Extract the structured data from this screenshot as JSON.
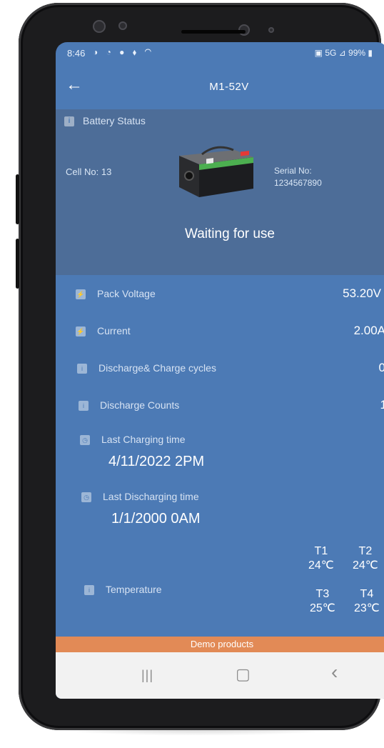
{
  "status_bar": {
    "time": "8:46",
    "left_icons": "◑ ◔ ● ⬧ ◠",
    "right_text": "▣ 5G ⊿ 99% ▮"
  },
  "app_bar": {
    "title": "M1-52V",
    "back_icon": "arrow-left"
  },
  "battery_status": {
    "section_label": "Battery Status",
    "cell_no": "Cell No:  13",
    "serial_label": "Serial No:",
    "serial_value": "1234567890",
    "state": "Waiting for use"
  },
  "metrics": [
    {
      "label": "Pack Voltage",
      "value": "53.20V"
    },
    {
      "label": "Current",
      "value": "2.00A"
    },
    {
      "label": "Discharge& Charge cycles",
      "value": "0"
    },
    {
      "label": "Discharge Counts",
      "value": "1"
    }
  ],
  "times": {
    "last_charging_label": "Last Charging time",
    "last_charging_value": "4/11/2022 2PM",
    "last_discharging_label": "Last Discharging time",
    "last_discharging_value": "1/1/2000 0AM"
  },
  "temperature": {
    "label": "Temperature",
    "t1_label": "T1",
    "t1_value": "24℃",
    "t2_label": "T2",
    "t2_value": "24℃",
    "t3_label": "T3",
    "t3_value": "25℃",
    "t4_label": "T4",
    "t4_value": "23℃"
  },
  "banner": {
    "text": "Demo products"
  },
  "nav": {
    "recents": "|||",
    "home": "▢",
    "back": "‹"
  },
  "colors": {
    "primary": "#4c7ab5",
    "card": "#4d6d98",
    "banner": "#e28a56"
  }
}
